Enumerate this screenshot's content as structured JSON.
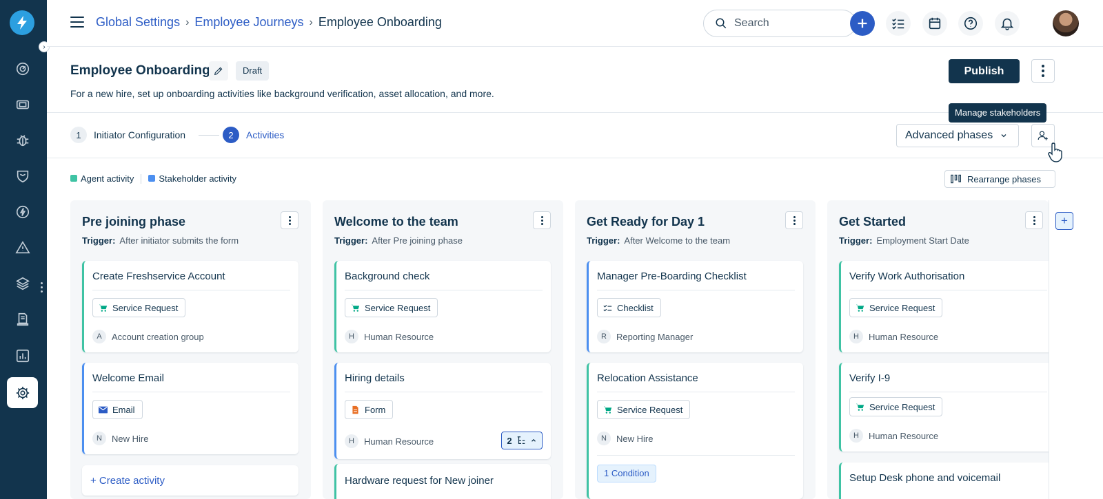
{
  "breadcrumb": {
    "items": [
      "Global Settings",
      "Employee Journeys"
    ],
    "current": "Employee Onboarding"
  },
  "search": {
    "placeholder": "Search"
  },
  "header": {
    "title": "Employee Onboarding",
    "status": "Draft",
    "description": "For a new hire, set up onboarding activities like background verification, asset allocation, and more.",
    "publish_label": "Publish"
  },
  "tooltip": "Manage stakeholders",
  "steps": [
    {
      "num": "1",
      "label": "Initiator Configuration"
    },
    {
      "num": "2",
      "label": "Activities"
    }
  ],
  "advanced_phases_label": "Advanced phases",
  "legend": {
    "agent": "Agent activity",
    "stakeholder": "Stakeholder activity"
  },
  "rearrange_label": "Rearrange phases",
  "colors": {
    "agent": "#3fc3a4",
    "stakeholder": "#4c8ff0",
    "primary": "#2c5cc5",
    "navy": "#12344d"
  },
  "trigger_label": "Trigger:",
  "phases": [
    {
      "title": "Pre joining phase",
      "trigger": "After initiator submits the form",
      "cards": [
        {
          "title": "Create Freshservice Account",
          "tag": "Service Request",
          "tag_icon": "cart-icon",
          "initial": "A",
          "assignee": "Account creation group"
        },
        {
          "title": "Welcome Email",
          "tag": "Email",
          "tag_icon": "email-icon",
          "initial": "N",
          "assignee": "New Hire"
        }
      ],
      "create_label": "+ Create activity"
    },
    {
      "title": "Welcome to the team",
      "trigger": "After Pre joining phase",
      "cards": [
        {
          "title": "Background check",
          "tag": "Service Request",
          "tag_icon": "cart-icon",
          "initial": "H",
          "assignee": "Human Resource"
        },
        {
          "title": "Hiring details",
          "tag": "Form",
          "tag_icon": "form-icon",
          "initial": "H",
          "assignee": "Human Resource",
          "child_count": "2"
        },
        {
          "title": "Hardware request for New joiner"
        }
      ]
    },
    {
      "title": "Get Ready for Day 1",
      "trigger": "After Welcome to the team",
      "cards": [
        {
          "title": "Manager Pre-Boarding Checklist",
          "tag": "Checklist",
          "tag_icon": "checklist-icon",
          "initial": "R",
          "assignee": "Reporting Manager"
        },
        {
          "title": "Relocation Assistance",
          "tag": "Service Request",
          "tag_icon": "cart-icon",
          "initial": "N",
          "assignee": "New Hire",
          "condition": "1 Condition"
        }
      ]
    },
    {
      "title": "Get Started",
      "trigger": "Employment Start Date",
      "cards": [
        {
          "title": "Verify Work Authorisation",
          "tag": "Service Request",
          "tag_icon": "cart-icon",
          "initial": "H",
          "assignee": "Human Resource"
        },
        {
          "title": "Verify I-9",
          "tag": "Service Request",
          "tag_icon": "cart-icon",
          "initial": "H",
          "assignee": "Human Resource"
        },
        {
          "title": "Setup Desk phone and voicemail"
        }
      ]
    }
  ]
}
